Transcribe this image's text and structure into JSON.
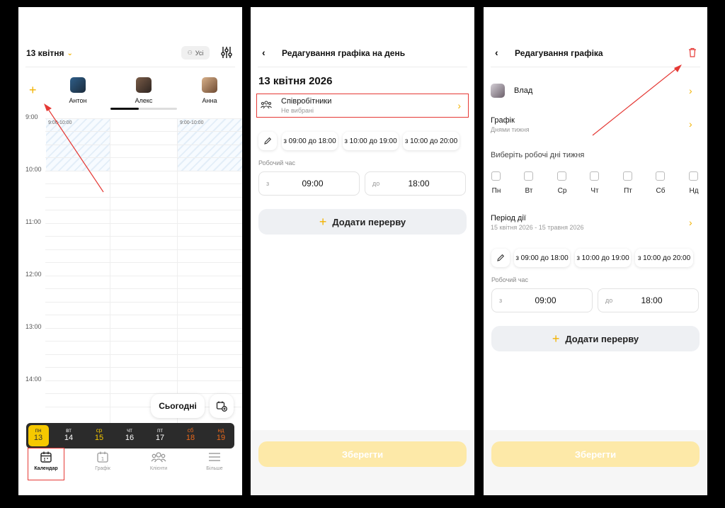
{
  "screen1": {
    "header": {
      "date": "13 квітня",
      "all_label": "Усі"
    },
    "staff": [
      {
        "name": "Антон"
      },
      {
        "name": "Алекс"
      },
      {
        "name": "Анна"
      }
    ],
    "times": [
      "9:00",
      "10:00",
      "11:00",
      "12:00",
      "13:00",
      "14:00"
    ],
    "events": [
      "9:00-10:00",
      "9:00-10:00"
    ],
    "today_button": "Сьогодні",
    "week": [
      {
        "wd": "пн",
        "d": "13"
      },
      {
        "wd": "вт",
        "d": "14"
      },
      {
        "wd": "ср",
        "d": "15"
      },
      {
        "wd": "чт",
        "d": "16"
      },
      {
        "wd": "пт",
        "d": "17"
      },
      {
        "wd": "сб",
        "d": "18"
      },
      {
        "wd": "нд",
        "d": "19"
      }
    ],
    "nav": [
      {
        "label": "Календар"
      },
      {
        "label": "Графік"
      },
      {
        "label": "Клієнти"
      },
      {
        "label": "Більше"
      }
    ]
  },
  "screen2": {
    "title": "Редагування графіка на день",
    "date": "13 квітня 2026",
    "employees_label": "Співробітники",
    "employees_sub": "Не вибрані",
    "presets": [
      "з 09:00 до 18:00",
      "з 10:00 до 19:00",
      "з 10:00 до 20:00"
    ],
    "work_time_label": "Робочий час",
    "from_label": "з",
    "from_value": "09:00",
    "to_label": "до",
    "to_value": "18:00",
    "add_break": "Додати перерву",
    "save": "Зберегти"
  },
  "screen3": {
    "title": "Редагування графіка",
    "employee_name": "Влад",
    "schedule_label": "Графік",
    "schedule_sub": "Днями тижня",
    "weekdays_prompt": "Виберіть робочі дні тижня",
    "weekdays": [
      "Пн",
      "Вт",
      "Ср",
      "Чт",
      "Пт",
      "Сб",
      "Нд"
    ],
    "period_label": "Період дії",
    "period_value": "15 квітня 2026 - 15 травня 2026",
    "presets": [
      "з 09:00 до 18:00",
      "з 10:00 до 19:00",
      "з 10:00 до 20:00"
    ],
    "work_time_label": "Робочий час",
    "from_label": "з",
    "from_value": "09:00",
    "to_label": "до",
    "to_value": "18:00",
    "add_break": "Додати перерву",
    "save": "Зберегти"
  },
  "colors": {
    "accent": "#f2b200",
    "highlight": "#e53935",
    "weekend": "#e8681c"
  }
}
